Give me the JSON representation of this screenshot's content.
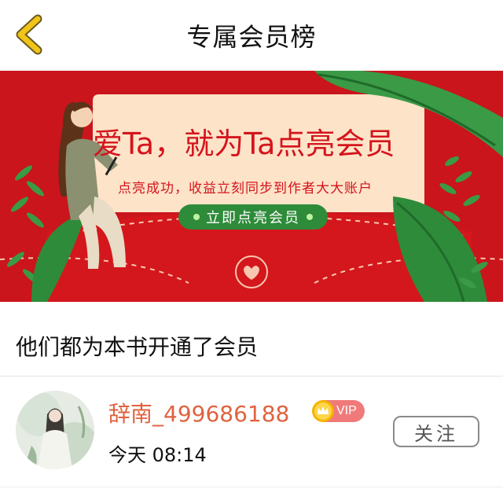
{
  "header": {
    "title": "专属会员榜",
    "back_icon": "chevron-left-icon",
    "back_color": "#f0c419"
  },
  "banner": {
    "headline": "爱Ta，就为Ta点亮会员",
    "subtitle": "点亮成功，收益立刻同步到作者大大账户",
    "cta_label": "立即点亮会员",
    "colors": {
      "background": "#d71a1f",
      "card": "#fde3c8",
      "text": "#d4141d",
      "cta": "#2e8b3a",
      "leaves": "#2e8b3a"
    }
  },
  "section": {
    "title": "他们都为本书开通了会员"
  },
  "members": [
    {
      "name": "辞南_499686188",
      "vip_label": "VIP",
      "time": "今天 08:14",
      "follow_label": "关注",
      "name_color": "#e0623e",
      "vip_color": "#f07a7a"
    }
  ]
}
